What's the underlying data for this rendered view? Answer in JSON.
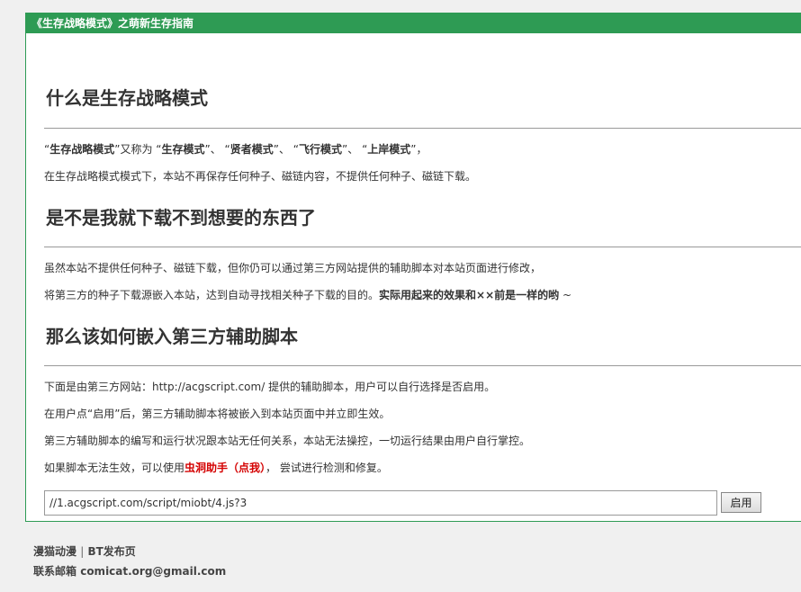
{
  "panel": {
    "title": "《生存战略模式》之萌新生存指南"
  },
  "sections": [
    {
      "heading": "什么是生存战略模式",
      "lines": [
        {
          "parts": [
            {
              "text": "“",
              "bold": false
            },
            {
              "text": "生存战略模式",
              "bold": true
            },
            {
              "text": "”又称为 “",
              "bold": false
            },
            {
              "text": "生存模式",
              "bold": true
            },
            {
              "text": "”、 “",
              "bold": false
            },
            {
              "text": "贤者模式",
              "bold": true
            },
            {
              "text": "”、 “",
              "bold": false
            },
            {
              "text": "飞行模式",
              "bold": true
            },
            {
              "text": "”、 “",
              "bold": false
            },
            {
              "text": "上岸模式",
              "bold": true
            },
            {
              "text": "”，",
              "bold": false
            }
          ]
        },
        {
          "text": "在生存战略模式模式下，本站不再保存任何种子、磁链内容，不提供任何种子、磁链下载。"
        }
      ]
    },
    {
      "heading": "是不是我就下载不到想要的东西了",
      "lines": [
        {
          "text": "虽然本站不提供任何种子、磁链下载，但你仍可以通过第三方网站提供的辅助脚本对本站页面进行修改，"
        },
        {
          "text": "将第三方的种子下载源嵌入本站，达到自动寻找相关种子下载的目的。",
          "bold_suffix": "实际用起来的效果和××前是一样的哟",
          "suffix": " ~"
        }
      ]
    },
    {
      "heading": "那么该如何嵌入第三方辅助脚本",
      "lines": [
        {
          "text": "下面是由第三方网站：http://acgscript.com/ 提供的辅助脚本，用户可以自行选择是否启用。"
        },
        {
          "text": "在用户点“启用”后，第三方辅助脚本将被嵌入到本站页面中并立即生效。"
        },
        {
          "text": "第三方辅助脚本的编写和运行状况跟本站无任何关系，本站无法操控，一切运行结果由用户自行掌控。"
        },
        {
          "text": "如果脚本无法生效，可以使用",
          "link": "虫洞助手（点我）",
          "suffix": "， 尝试进行检测和修复。"
        }
      ]
    }
  ],
  "script_input": {
    "value": "//1.acgscript.com/script/miobt/4.js?3"
  },
  "enable_button": {
    "label": "启用"
  },
  "footer": {
    "site_name": "漫猫动漫",
    "separator": "|",
    "bt_page": "BT发布页",
    "email_label": "联系邮箱",
    "email": "comicat.org@gmail.com"
  },
  "colors": {
    "accent": "#2e9b54",
    "link_red": "#d40000"
  }
}
